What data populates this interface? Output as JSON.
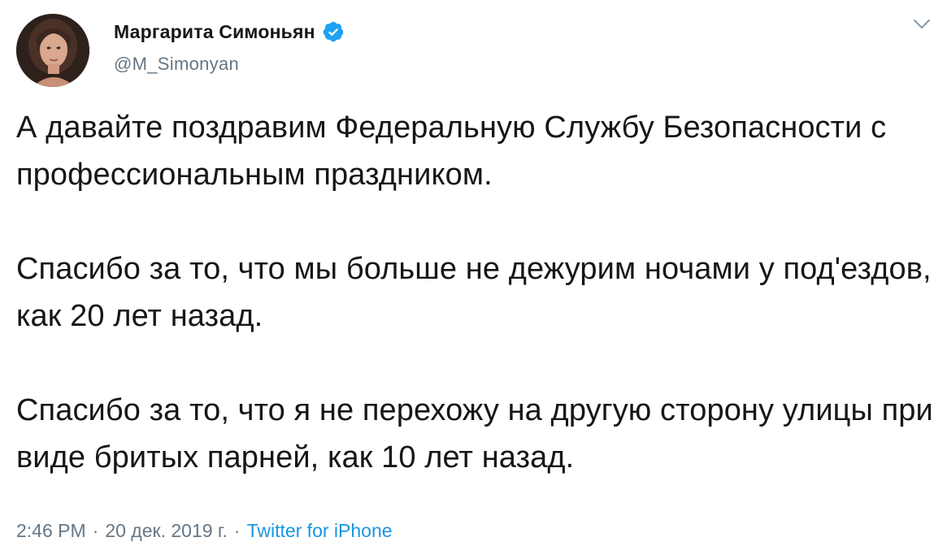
{
  "author": {
    "display_name": "Маргарита Симоньян",
    "handle": "@M_Simonyan",
    "verified": true
  },
  "tweet": {
    "paragraphs": [
      "А давайте поздравим Федеральную Службу Безопасности с профессиональным праздником.",
      "Спасибо за то, что мы больше не дежурим ночами у под'ездов, как 20 лет назад.",
      "Спасибо за то, что я не перехожу на другую сторону улицы при виде бритых парней, как 10 лет назад."
    ]
  },
  "meta": {
    "time": "2:46 PM",
    "separator": "·",
    "date": "20 дек. 2019 г.",
    "source": "Twitter for iPhone"
  },
  "icons": {
    "verified": "verified-badge-icon",
    "menu": "chevron-down-icon"
  },
  "colors": {
    "text": "#14171a",
    "secondary": "#657786",
    "link": "#1b95e0",
    "verified": "#1da1f2"
  }
}
